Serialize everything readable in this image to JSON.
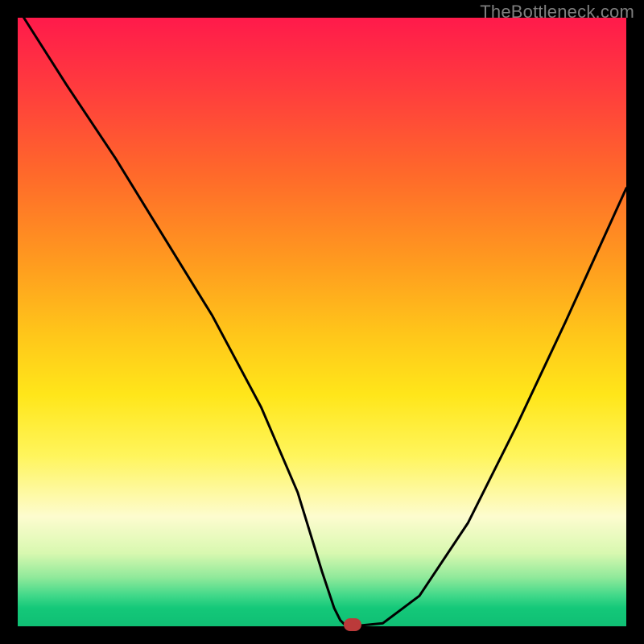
{
  "watermark": "TheBottleneck.com",
  "chart_data": {
    "type": "line",
    "title": "",
    "xlabel": "",
    "ylabel": "",
    "xlim": [
      0,
      100
    ],
    "ylim": [
      0,
      100
    ],
    "grid": false,
    "series": [
      {
        "name": "curve",
        "x": [
          1,
          8,
          16,
          24,
          32,
          40,
          46,
          50,
          52,
          53,
          54,
          55,
          60,
          66,
          74,
          82,
          90,
          100
        ],
        "y": [
          100,
          89,
          77,
          64,
          51,
          36,
          22,
          9,
          3,
          1,
          0,
          0,
          0.5,
          5,
          17,
          33,
          50,
          72
        ]
      }
    ],
    "marker": {
      "x": 55,
      "y": 0.3,
      "color": "#bb3a3a"
    },
    "colors": {
      "curve": "#000000",
      "gradient_top": "#ff1a4b",
      "gradient_bottom": "#0fbf74"
    }
  }
}
